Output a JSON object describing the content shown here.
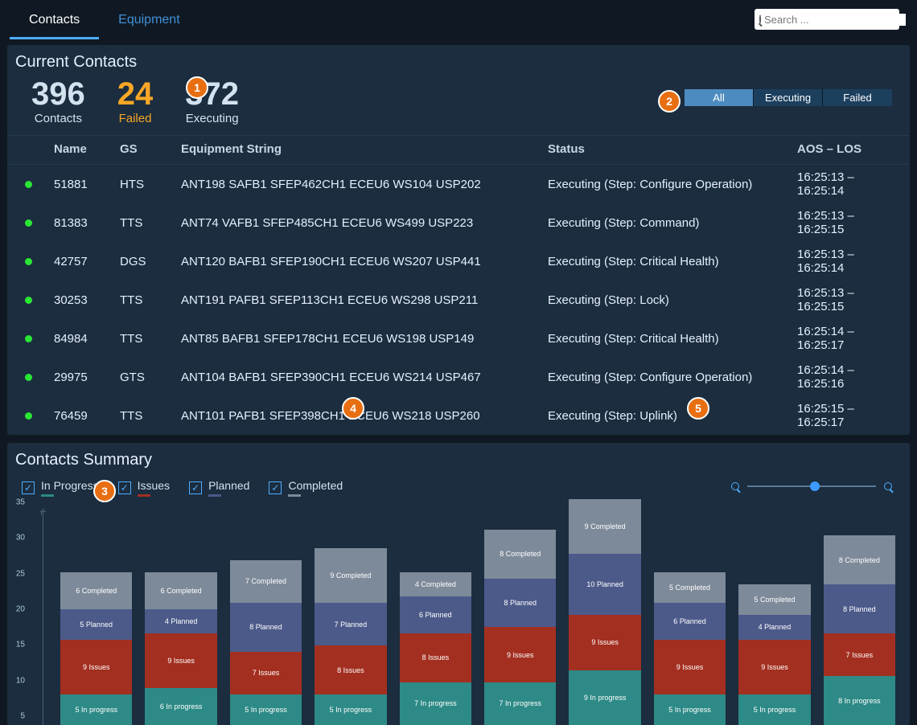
{
  "nav": {
    "tabs": [
      "Contacts",
      "Equipment"
    ],
    "active": "Contacts",
    "search_placeholder": "Search ..."
  },
  "contacts_panel": {
    "title": "Current Contacts",
    "stats": {
      "total": {
        "num": "396",
        "label": "Contacts"
      },
      "failed": {
        "num": "24",
        "label": "Failed"
      },
      "executing": {
        "num": "372",
        "label": "Executing"
      }
    },
    "filters": {
      "options": [
        "All",
        "Executing",
        "Failed"
      ],
      "active": "All"
    },
    "columns": [
      "Name",
      "GS",
      "Equipment String",
      "Status",
      "AOS – LOS"
    ],
    "rows": [
      {
        "name": "51881",
        "gs": "HTS",
        "eq": "ANT198 SAFB1 SFEP462CH1 ECEU6 WS104 USP202",
        "status": "Executing (Step: Configure Operation)",
        "aos": "16:25:13 – 16:25:14"
      },
      {
        "name": "81383",
        "gs": "TTS",
        "eq": "ANT74 VAFB1 SFEP485CH1 ECEU6 WS499 USP223",
        "status": "Executing (Step: Command)",
        "aos": "16:25:13 – 16:25:15"
      },
      {
        "name": "42757",
        "gs": "DGS",
        "eq": "ANT120 BAFB1 SFEP190CH1 ECEU6 WS207 USP441",
        "status": "Executing (Step: Critical Health)",
        "aos": "16:25:13 – 16:25:14"
      },
      {
        "name": "30253",
        "gs": "TTS",
        "eq": "ANT191 PAFB1 SFEP113CH1 ECEU6 WS298 USP211",
        "status": "Executing (Step: Lock)",
        "aos": "16:25:13 – 16:25:15"
      },
      {
        "name": "84984",
        "gs": "TTS",
        "eq": "ANT85 BAFB1 SFEP178CH1 ECEU6 WS198 USP149",
        "status": "Executing (Step: Critical Health)",
        "aos": "16:25:14 – 16:25:17"
      },
      {
        "name": "29975",
        "gs": "GTS",
        "eq": "ANT104 BAFB1 SFEP390CH1 ECEU6 WS214 USP467",
        "status": "Executing (Step: Configure Operation)",
        "aos": "16:25:14 – 16:25:16"
      },
      {
        "name": "76459",
        "gs": "TTS",
        "eq": "ANT101 PAFB1 SFEP398CH1 ECEU6 WS218 USP260",
        "status": "Executing (Step: Uplink)",
        "aos": "16:25:15 – 16:25:17"
      }
    ]
  },
  "summary_panel": {
    "title": "Contacts Summary",
    "legend": [
      {
        "label": "In Progress",
        "swatch": "sw-prog"
      },
      {
        "label": "Issues",
        "swatch": "sw-iss"
      },
      {
        "label": "Planned",
        "swatch": "sw-plan"
      },
      {
        "label": "Completed",
        "swatch": "sw-comp"
      }
    ],
    "y_ticks": [
      5,
      10,
      15,
      20,
      25,
      30,
      35
    ]
  },
  "chart_data": {
    "type": "bar",
    "stacked": true,
    "yrange": [
      5,
      35
    ],
    "ylabel": "",
    "xlabel": "",
    "segments": [
      "In progress",
      "Issues",
      "Planned",
      "Completed"
    ],
    "series": [
      {
        "in_progress": 5,
        "issues": 9,
        "planned": 5,
        "completed": 6
      },
      {
        "in_progress": 6,
        "issues": 9,
        "planned": 4,
        "completed": 6
      },
      {
        "in_progress": 5,
        "issues": 7,
        "planned": 8,
        "completed": 7
      },
      {
        "in_progress": 5,
        "issues": 8,
        "planned": 7,
        "completed": 9
      },
      {
        "in_progress": 7,
        "issues": 8,
        "planned": 6,
        "completed": 4
      },
      {
        "in_progress": 7,
        "issues": 9,
        "planned": 8,
        "completed": 8
      },
      {
        "in_progress": 9,
        "issues": 9,
        "planned": 10,
        "completed": 9
      },
      {
        "in_progress": 5,
        "issues": 9,
        "planned": 6,
        "completed": 5
      },
      {
        "in_progress": 5,
        "issues": 9,
        "planned": 4,
        "completed": 5
      },
      {
        "in_progress": 8,
        "issues": 7,
        "planned": 8,
        "completed": 8
      }
    ]
  },
  "annotations": [
    "1",
    "2",
    "3",
    "4",
    "5"
  ]
}
